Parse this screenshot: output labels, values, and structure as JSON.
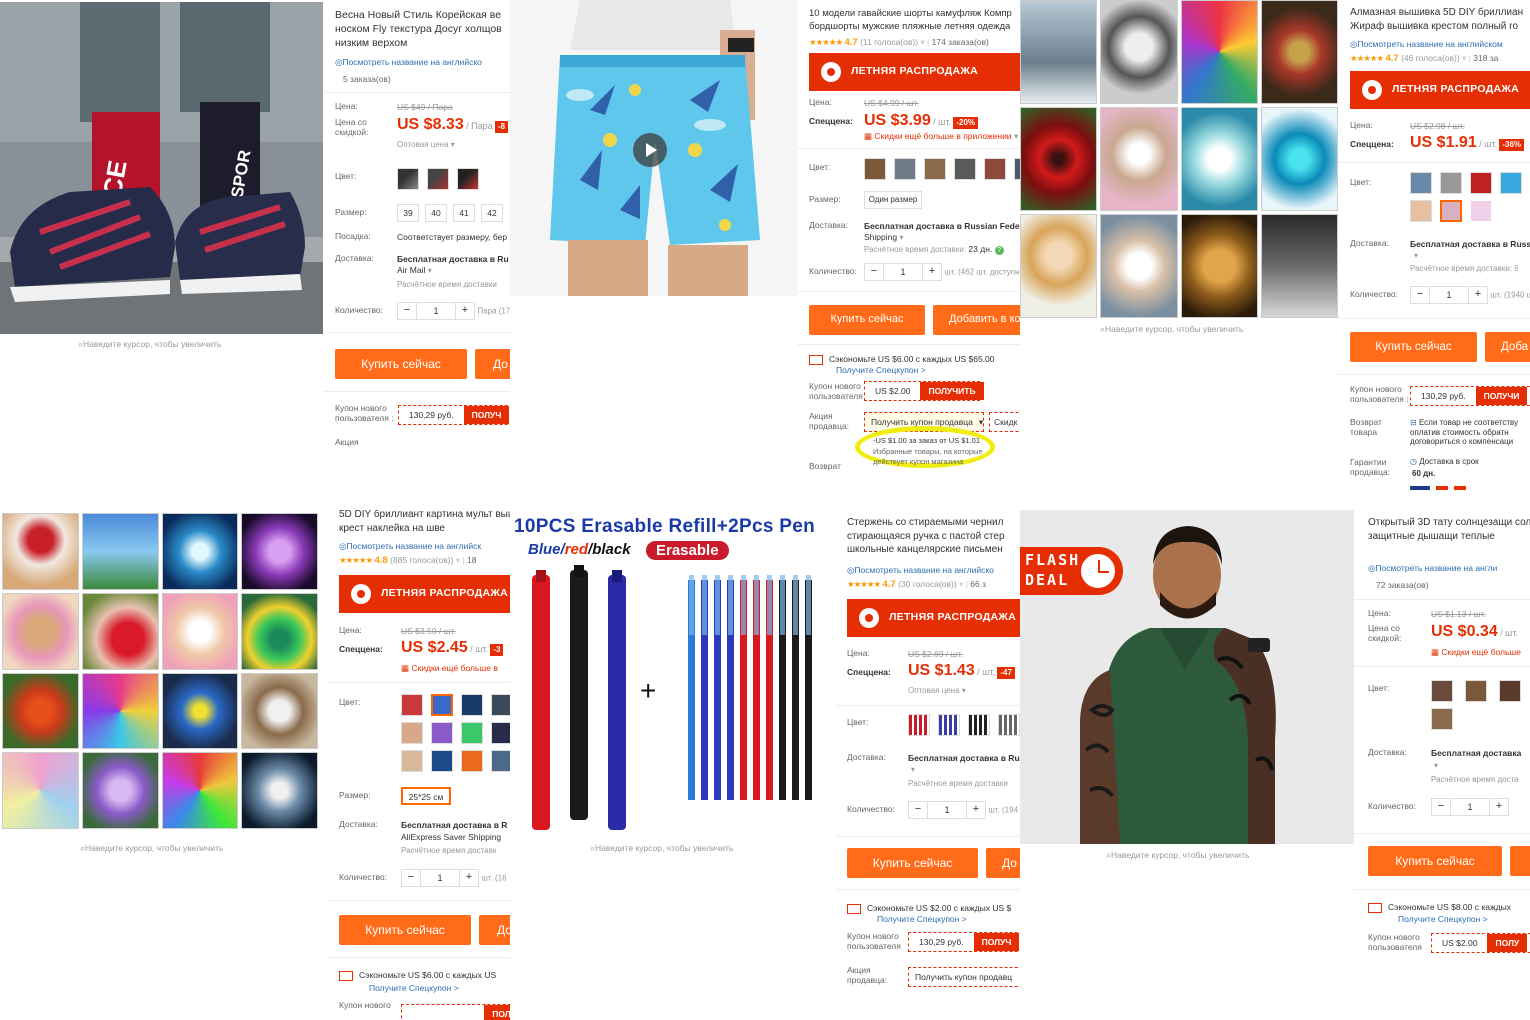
{
  "zoom_hint": "Наведите курсор, чтобы увеличить",
  "p1": {
    "title": "Весна Новый Стиль Корейская ве носком Fly текстура Досуг холщов низким верхом",
    "translate": "Посмотреть название на английско",
    "orders": "5 заказа(ов)",
    "price_label": "Цена:",
    "old_price": "US $49 / Пара",
    "discount_label": "Цена со скидкой:",
    "price": "US $8.33",
    "per": "/ Пара",
    "wholesale": "Оптовая цена",
    "color_label": "Цвет:",
    "size_label": "Размер:",
    "sizes": [
      "39",
      "40",
      "41",
      "42"
    ],
    "fit_label": "Посадка:",
    "fit": "Соответствует размеру, бер",
    "ship_label": "Доставка:",
    "ship": "Бесплатная доставка в Ru",
    "ship2": "Air Mail",
    "ship_time": "Расчётное время доставки",
    "qty_label": "Количество:",
    "qty": "1",
    "qty_unit": "Пара (17",
    "buy": "Купить сейчас",
    "add": "До",
    "coupon_label": "Купон нового пользователя :",
    "coupon_value": "130,29 руб.",
    "coupon_btn": "ПОЛУЧ",
    "promo_label": "Акция"
  },
  "p2": {
    "title": "10 модели гавайские шорты камуфляж Компр бордшорты мужские пляжные летняя одежда",
    "rating": "4.7",
    "votes": "(11 голоса(ов))",
    "orders": "174 заказа(ов)",
    "sale": "ЛЕТНЯЯ РАСПРОДАЖА",
    "price_label": "Цена:",
    "old_price": "US $4.99 / шт.",
    "special_label": "Спеццена:",
    "price": "US $3.99",
    "per": "/ шт.",
    "discount": "-20%",
    "app_discount": "Скидки ещё больше в приложении",
    "color_label": "Цвет:",
    "size_label": "Размер:",
    "size": "Один размер",
    "ship_label": "Доставка:",
    "ship": "Бесплатная доставка в Russian Federati",
    "ship2": "Shipping",
    "ship_time": "Расчётное время доставки:",
    "ship_days": "23 дн.",
    "qty_label": "Количество:",
    "qty": "1",
    "qty_unit": "шт. (462 шт. доступно)",
    "buy": "Купить сейчас",
    "add": "Добавить в ко",
    "save": "Сэкономьте US $6.00 с каждых US $65.00",
    "save_link": "Получите Спецкупон >",
    "coupon_label": "Купон нового пользователя",
    "coupon_value": "US $2.00",
    "coupon_btn": "ПОЛУЧИТЬ",
    "seller_label": "Акция продавца:",
    "seller_btn": "Получить купон продавца",
    "seller_disc": "Скидк",
    "popup1": "-US $1.00 за заказ от US $1.01",
    "popup2": "Избранные товары, на которые",
    "popup3": "действует купон магазина",
    "return_label": "Возврат"
  },
  "p3": {
    "title": "Алмазная вышивка 5D DIY бриллиан Жираф вышивка крестом полный ro",
    "translate": "Посмотреть название на английском",
    "rating": "4.7",
    "votes": "(46 голоса(ов))",
    "orders": "318 за",
    "sale": "ЛЕТНЯЯ РАСПРОДАЖА",
    "price_label": "Цена:",
    "old_price": "US $2.98 / шт.",
    "special_label": "Спеццена:",
    "price": "US $1.91",
    "per": "/ шт.",
    "discount": "-36%",
    "color_label": "Цвет:",
    "ship_label": "Доставка:",
    "ship": "Бесплатная доставка в Russ",
    "ship_time": "Расчётное время доставки: 6",
    "qty_label": "Количество:",
    "qty": "1",
    "qty_unit": "шт. (1940 ш",
    "buy": "Купить сейчас",
    "add": "Доба",
    "coupon_label": "Купон нового пользователя :",
    "coupon_value": "130,29 руб.",
    "coupon_btn": "ПОЛУЧИ",
    "return_label": "Возврат товара",
    "return_text": "Если товар не соответству оплатив стоимость обратн договориться о компенсаци",
    "guarantee_label": "Гарантии продавца:",
    "guarantee": "Доставка в срок",
    "guarantee_days": "60 дн."
  },
  "p4": {
    "title": "5D DIY бриллиант картина мульт вышивка крест наклейка на шве",
    "translate": "Посмотреть название на английск",
    "rating": "4.8",
    "votes": "(885 голоса(ов))",
    "orders": "18",
    "sale": "ЛЕТНЯЯ РАСПРОДАЖА",
    "price_label": "Цена:",
    "old_price": "US $3.50 / шт.",
    "special_label": "Спеццена:",
    "price": "US $2.45",
    "per": "/ шт.",
    "discount": "-3",
    "app_discount": "Скидки ещё больше в",
    "color_label": "Цвет:",
    "size_label": "Размер:",
    "size": "25*25 см",
    "ship_label": "Доставка:",
    "ship": "Бесплатная доставка в R",
    "ship2": "AliExpress Saver Shipping",
    "ship_time": "Расчётное время доставк",
    "qty_label": "Количество:",
    "qty": "1",
    "qty_unit": "шт. (16",
    "buy": "Купить сейчас",
    "add": "До",
    "save": "Сэкономьте US $6.00 с каждых US",
    "save_link": "Получите Спецкупон >",
    "coupon_label": "Купон нового",
    "coupon_btn": "ПОЛУЧ"
  },
  "p5": {
    "headline": "10PCS Erasable Refill+2Pcs Pen",
    "colors_line_a": "Blue/",
    "colors_line_b": "red",
    "colors_line_c": "/black",
    "erasable": "Erasable",
    "title": "Стержень со стираемыми чернил стирающаяся ручка с пастой стер школьные канцелярские письмен",
    "translate": "Посмотреть название на английско",
    "rating": "4.7",
    "votes": "(30 голоса(ов))",
    "orders": "66 з",
    "sale": "ЛЕТНЯЯ РАСПРОДАЖА",
    "price_label": "Цена:",
    "old_price": "US $2.69 / шт.",
    "special_label": "Спеццена:",
    "price": "US $1.43",
    "per": "/ шт.",
    "discount": "-47",
    "wholesale": "Оптовая цена",
    "color_label": "Цвет:",
    "ship_label": "Доставка:",
    "ship": "Бесплатная доставка в Ru",
    "ship_time": "Расчётное время доставки",
    "qty_label": "Количество:",
    "qty": "1",
    "qty_unit": "шт. (194",
    "buy": "Купить сейчас",
    "add": "До",
    "save": "Сэкономьте US $2.00 с каждых US $",
    "save_link": "Получите Спецкупон >",
    "coupon_label": "Купон нового пользователя",
    "coupon_value": "130,29 руб.",
    "coupon_btn": "ПОЛУЧ",
    "seller_label": "Акция продавца:",
    "seller_btn": "Получить купон продавц"
  },
  "p6": {
    "flash1": "FLASH",
    "flash2": "DEAL",
    "title": "Открытый 3D тату солнцезащи солнца УФ защитные дышащи теплые",
    "translate": "Посмотреть название на англи",
    "orders": "72 заказа(ов)",
    "price_label": "Цена:",
    "old_price": "US $1.13 / шт.",
    "discount_label": "Цена со скидкой:",
    "price": "US $0.34",
    "per": "/ шт.",
    "app_discount": "Скидки ещё больше",
    "color_label": "Цвет:",
    "ship_label": "Доставка:",
    "ship": "Бесплатная доставка",
    "ship_time": "Расчётное время доста",
    "qty_label": "Количество:",
    "qty": "1",
    "buy": "Купить сейчас",
    "save": "Сэкономьте US $8.00 с каждых",
    "save_link": "Получите Спецкупон >",
    "coupon_label": "Купон нового пользователя",
    "coupon_value": "US $2.00",
    "coupon_btn": "ПОЛУ"
  },
  "colors": {
    "accent": "#e62e04",
    "buy": "#ff6b18",
    "link": "#2d6eb5",
    "star": "#ff9900"
  }
}
